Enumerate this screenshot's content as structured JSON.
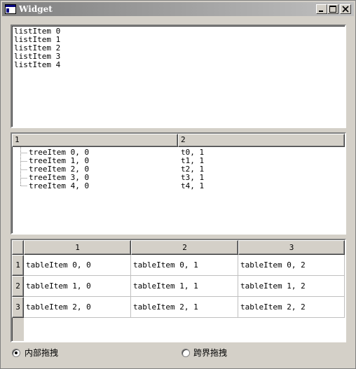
{
  "window": {
    "title": "Widget"
  },
  "list": {
    "items": [
      "listItem 0",
      "listItem 1",
      "listItem 2",
      "listItem 3",
      "listItem 4"
    ]
  },
  "tree": {
    "headers": [
      "1",
      "2"
    ],
    "rows": [
      {
        "col1": "treeItem 0, 0",
        "col2": "t0, 1"
      },
      {
        "col1": "treeItem 1, 0",
        "col2": "t1, 1"
      },
      {
        "col1": "treeItem 2, 0",
        "col2": "t2, 1"
      },
      {
        "col1": "treeItem 3, 0",
        "col2": "t3, 1"
      },
      {
        "col1": "treeItem 4, 0",
        "col2": "t4, 1"
      }
    ]
  },
  "table": {
    "col_headers": [
      "1",
      "2",
      "3"
    ],
    "row_headers": [
      "1",
      "2",
      "3"
    ],
    "rows": [
      [
        "tableItem 0, 0",
        "tableItem 0, 1",
        "tableItem 0, 2"
      ],
      [
        "tableItem 1, 0",
        "tableItem 1, 1",
        "tableItem 1, 2"
      ],
      [
        "tableItem 2, 0",
        "tableItem 2, 1",
        "tableItem 2, 2"
      ]
    ]
  },
  "drag_mode": {
    "options": [
      {
        "label": "内部拖拽",
        "checked": true
      },
      {
        "label": "跨界拖拽",
        "checked": false
      }
    ]
  }
}
